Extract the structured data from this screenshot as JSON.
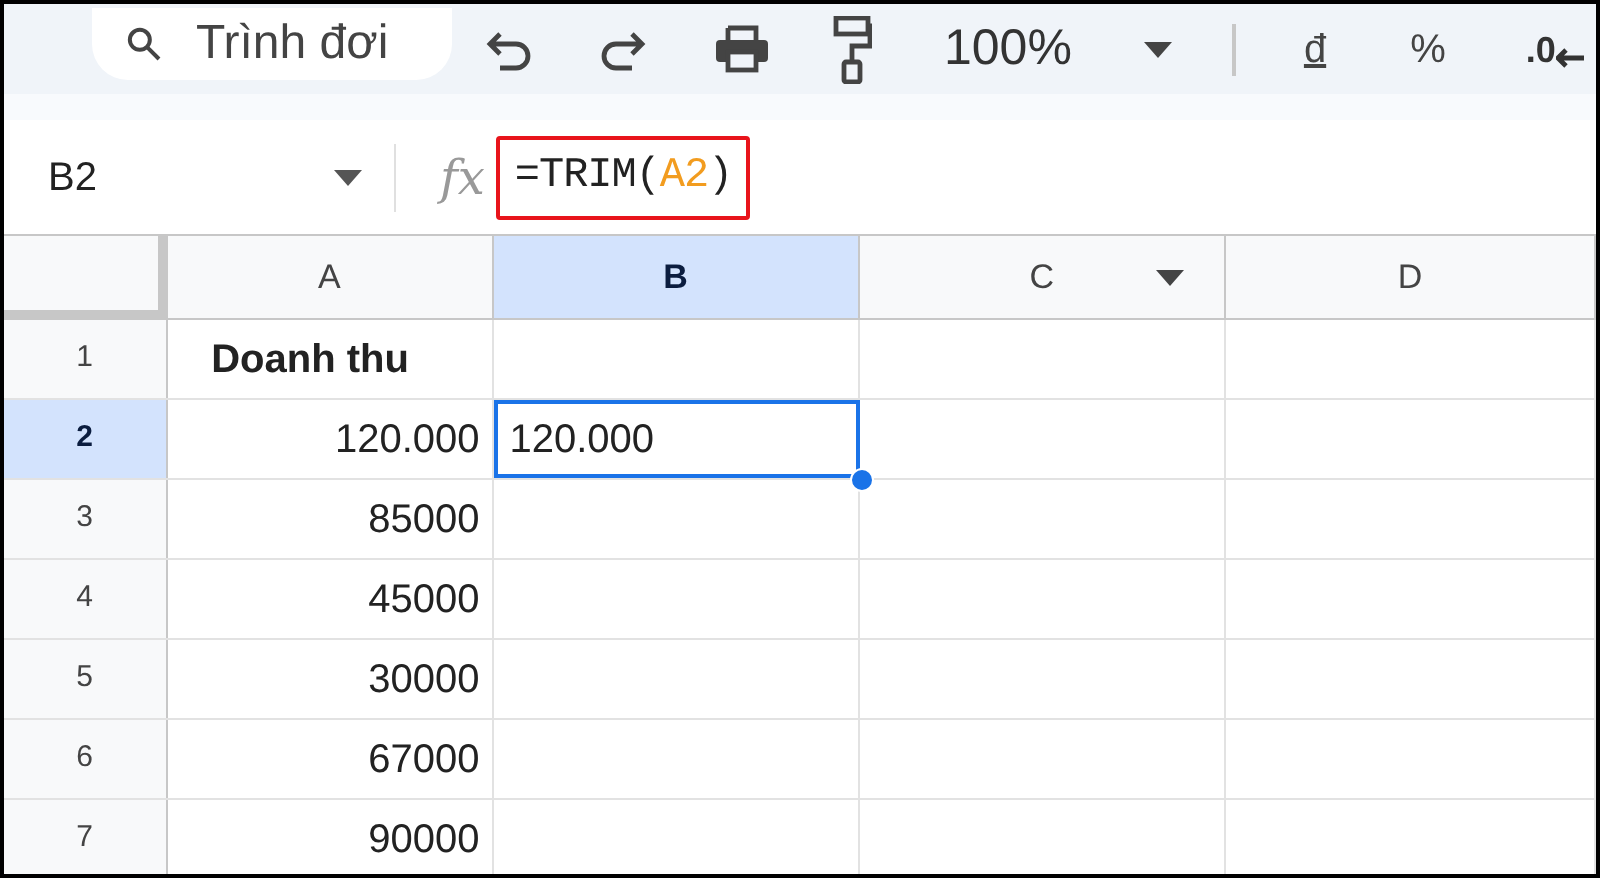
{
  "toolbar": {
    "search": {
      "placeholder": "Trình đơi"
    },
    "zoom": "100%",
    "currency": "đ",
    "percent": "%",
    "decimal": ".0"
  },
  "formula_bar": {
    "name_box": "B2",
    "fx": "fx",
    "formula": {
      "before": "=TRIM(",
      "ref": "A2",
      "after": ")"
    },
    "highlighted": true
  },
  "grid": {
    "columns": [
      {
        "label": "A",
        "selected": false,
        "menu": false
      },
      {
        "label": "B",
        "selected": true,
        "menu": false
      },
      {
        "label": "C",
        "selected": false,
        "menu": true
      },
      {
        "label": "D",
        "selected": false,
        "menu": false
      }
    ],
    "rows": [
      {
        "label": "1",
        "selected": false,
        "cells": [
          {
            "text": "Doanh thu",
            "bold": true,
            "right_aligned": false
          },
          {
            "selected": false
          }
        ]
      },
      {
        "label": "2",
        "selected": true,
        "cells": [
          {
            "text": "120.000",
            "bold": false,
            "right_aligned": true
          },
          {
            "text": "120.000",
            "selected": true
          }
        ]
      },
      {
        "label": "3",
        "selected": false,
        "cells": [
          {
            "text": "85000",
            "bold": false,
            "right_aligned": true
          },
          {
            "selected": false
          }
        ]
      },
      {
        "label": "4",
        "selected": false,
        "cells": [
          {
            "text": "45000",
            "bold": false,
            "right_aligned": true
          },
          {
            "selected": false
          }
        ]
      },
      {
        "label": "5",
        "selected": false,
        "cells": [
          {
            "text": "30000",
            "bold": false,
            "right_aligned": true
          },
          {
            "selected": false
          }
        ]
      },
      {
        "label": "6",
        "selected": false,
        "cells": [
          {
            "text": "67000",
            "bold": false,
            "right_aligned": true
          },
          {
            "selected": false
          }
        ]
      },
      {
        "label": "7",
        "selected": false,
        "cells": [
          {
            "text": "90000",
            "bold": false,
            "right_aligned": true
          },
          {
            "selected": false
          }
        ]
      }
    ]
  }
}
